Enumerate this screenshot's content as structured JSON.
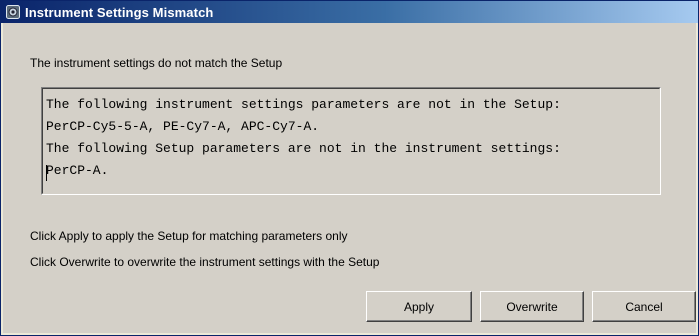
{
  "window": {
    "title": "Instrument Settings Mismatch",
    "icon": "instrument-settings-icon"
  },
  "message": "The instrument settings do not match the Setup",
  "details": {
    "lines": [
      "The following instrument settings parameters are not in the Setup:",
      "PerCP-Cy5-5-A, PE-Cy7-A, APC-Cy7-A.",
      "The following Setup parameters are not in the instrument settings:",
      "PerCP-A."
    ]
  },
  "info": {
    "apply_hint": "Click Apply to apply the Setup for matching parameters only",
    "overwrite_hint": "Click Overwrite to overwrite the instrument settings with the Setup"
  },
  "buttons": {
    "apply": "Apply",
    "overwrite": "Overwrite",
    "cancel": "Cancel"
  },
  "colors": {
    "title_start": "#0a246a",
    "title_end": "#a6caf0",
    "face": "#d4d0c8"
  }
}
